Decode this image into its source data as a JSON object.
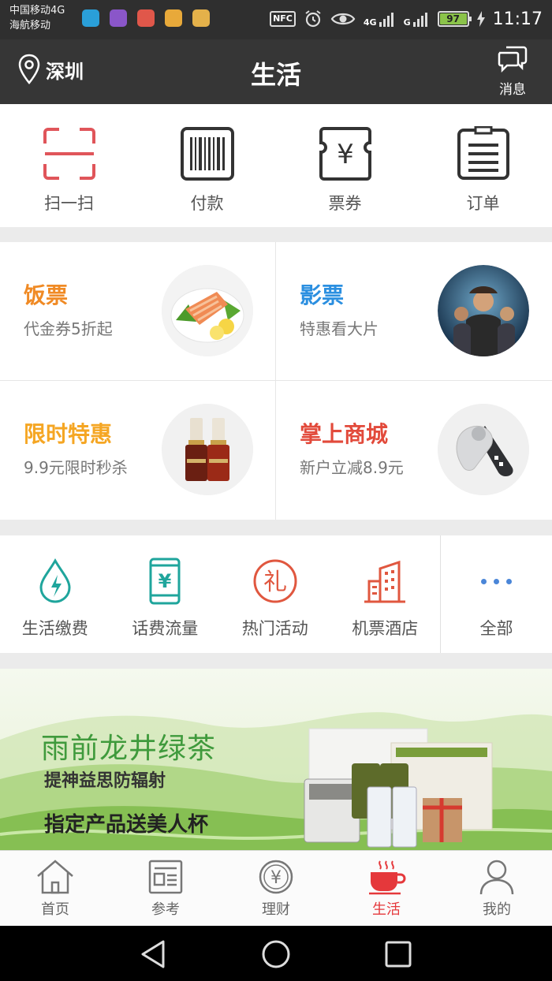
{
  "status_bar": {
    "carrier1": "中国移动4G",
    "carrier2": "海航移动",
    "nfc": "NFC",
    "net1": "4G",
    "net2": "G",
    "battery": "97",
    "time": "11:17"
  },
  "header": {
    "location": "深圳",
    "title": "生活",
    "message": "消息"
  },
  "quick_actions": [
    {
      "label": "扫一扫",
      "icon": "scan-icon"
    },
    {
      "label": "付款",
      "icon": "barcode-icon"
    },
    {
      "label": "票券",
      "icon": "ticket-icon"
    },
    {
      "label": "订单",
      "icon": "order-icon"
    }
  ],
  "promos": [
    {
      "title": "饭票",
      "subtitle": "代金券5折起",
      "color": "#f08a24",
      "image": "salmon-dish"
    },
    {
      "title": "影票",
      "subtitle": "特惠看大片",
      "color": "#2b8fe0",
      "image": "movie-poster"
    },
    {
      "title": "限时特惠",
      "subtitle": "9.9元限时秒杀",
      "color": "#f5a623",
      "image": "serum-bottles"
    },
    {
      "title": "掌上商城",
      "subtitle": "新户立减8.9元",
      "color": "#e24a3b",
      "image": "beauty-device"
    }
  ],
  "services": [
    {
      "label": "生活缴费",
      "icon": "water-bolt-icon"
    },
    {
      "label": "话费流量",
      "icon": "phone-yen-icon"
    },
    {
      "label": "热门活动",
      "icon": "gift-badge-icon"
    },
    {
      "label": "机票酒店",
      "icon": "building-icon"
    },
    {
      "label": "全部",
      "icon": "more-dots-icon"
    }
  ],
  "banner": {
    "title": "雨前龙井绿茶",
    "line1": "提神益思防辐射",
    "line2": "指定产品送美人杯"
  },
  "tabs": [
    {
      "label": "首页",
      "icon": "home-icon",
      "active": false
    },
    {
      "label": "参考",
      "icon": "news-icon",
      "active": false
    },
    {
      "label": "理财",
      "icon": "yen-coin-icon",
      "active": false
    },
    {
      "label": "生活",
      "icon": "coffee-cup-icon",
      "active": true
    },
    {
      "label": "我的",
      "icon": "user-icon",
      "active": false
    }
  ],
  "colors": {
    "accent_red": "#e5383b",
    "scan_red": "#e0555a",
    "teal": "#1fa59c"
  }
}
